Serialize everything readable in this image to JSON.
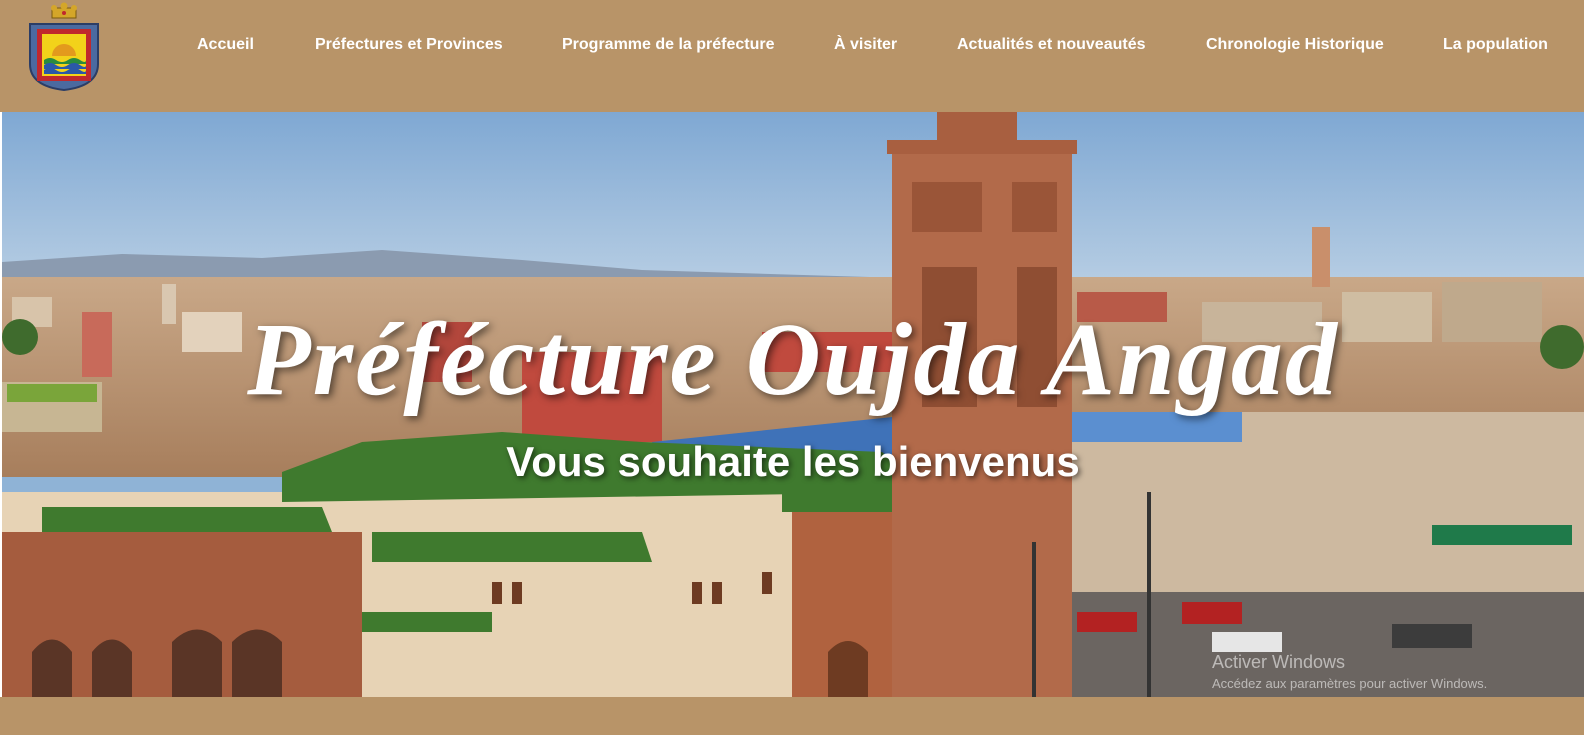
{
  "nav": {
    "items": [
      {
        "label": "Accueil"
      },
      {
        "label": "Préfectures et Provinces"
      },
      {
        "label": "Programme de la préfecture"
      },
      {
        "label": "À visiter"
      },
      {
        "label": "Actualités et nouveautés"
      },
      {
        "label": "Chronologie Historique"
      },
      {
        "label": "La population"
      }
    ]
  },
  "hero": {
    "title": "Préfécture Oujda Angad",
    "subtitle": "Vous souhaite les bienvenus"
  },
  "watermark": {
    "line1": "Activer Windows",
    "line2": "Accédez aux paramètres pour activer Windows."
  },
  "colors": {
    "header_bg": "#b89468",
    "nav_text": "#ffffff",
    "hero_text": "#ffffff"
  },
  "icons": {
    "logo": "prefecture-emblem-icon"
  }
}
